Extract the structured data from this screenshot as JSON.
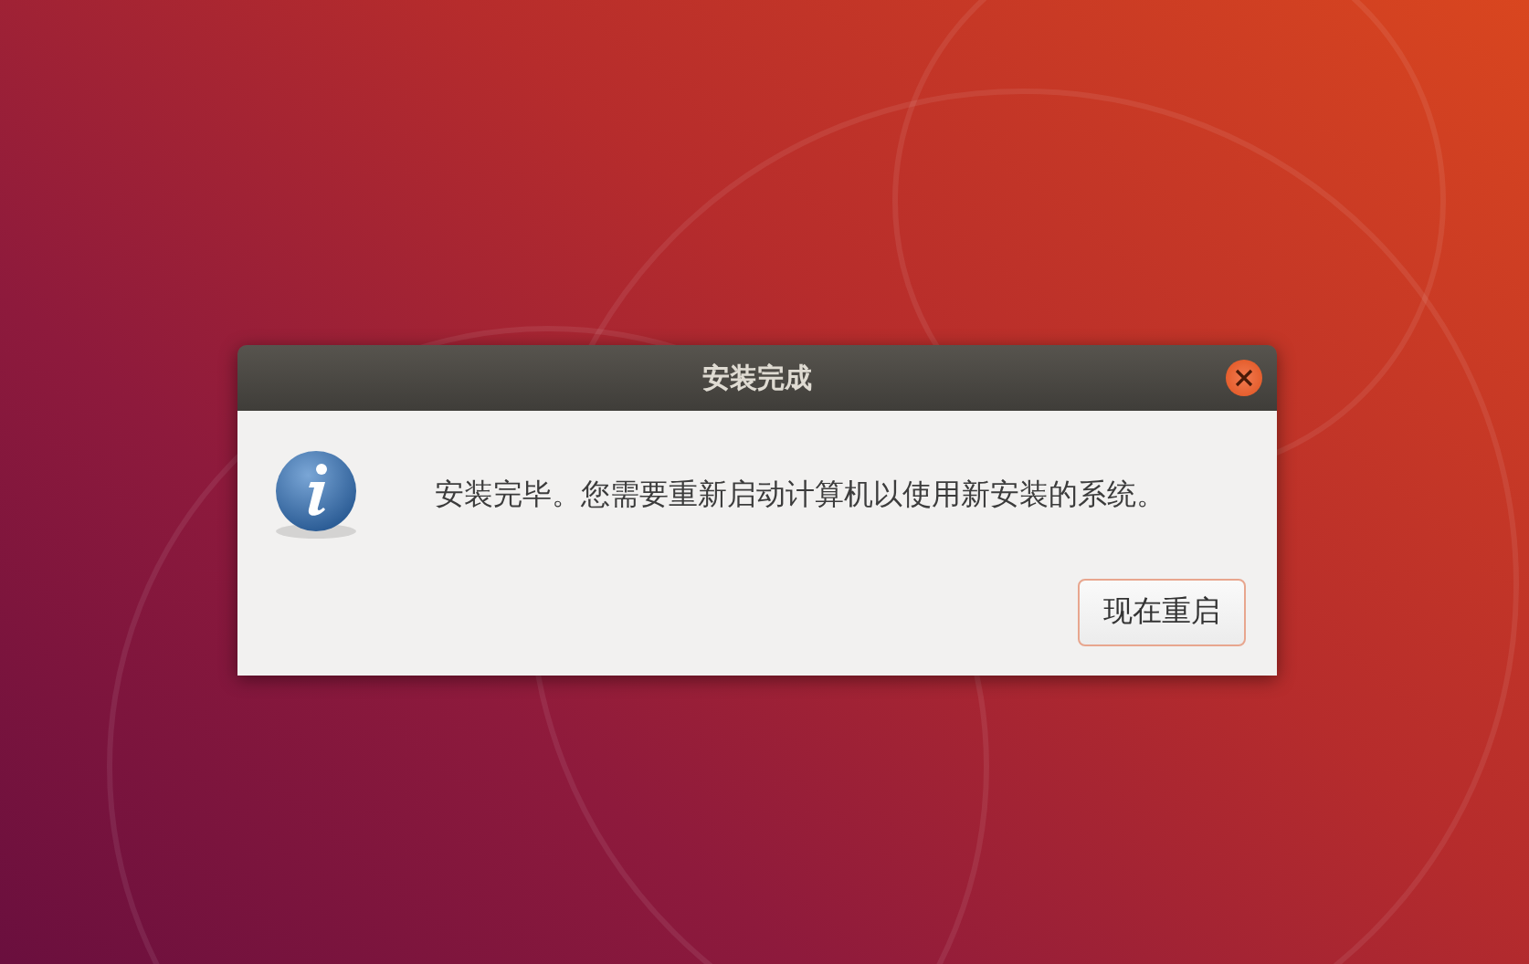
{
  "dialog": {
    "title": "安装完成",
    "message": "安装完毕。您需要重新启动计算机以使用新安装的系统。",
    "buttons": [
      "现在重启"
    ]
  }
}
